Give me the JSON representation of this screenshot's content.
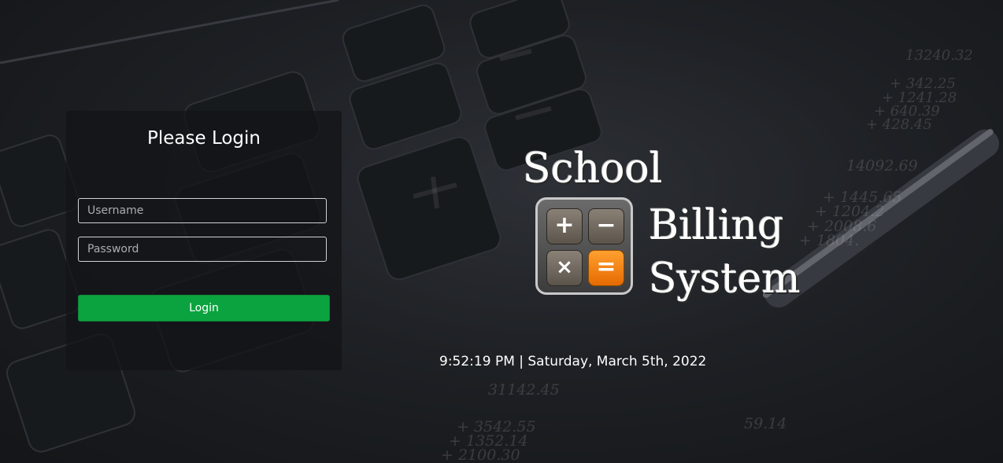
{
  "login": {
    "title": "Please Login",
    "username_placeholder": "Username",
    "password_placeholder": "Password",
    "button_label": "Login"
  },
  "logo": {
    "word1": "School",
    "word2": "Billing",
    "word3": "System",
    "keys": [
      "+",
      "−",
      "×",
      "="
    ]
  },
  "clock": {
    "text": "9:52:19 PM | Saturday, March 5th, 2022"
  },
  "colors": {
    "login_button": "#0aa33f",
    "equals_key": "#ff8c1a"
  }
}
